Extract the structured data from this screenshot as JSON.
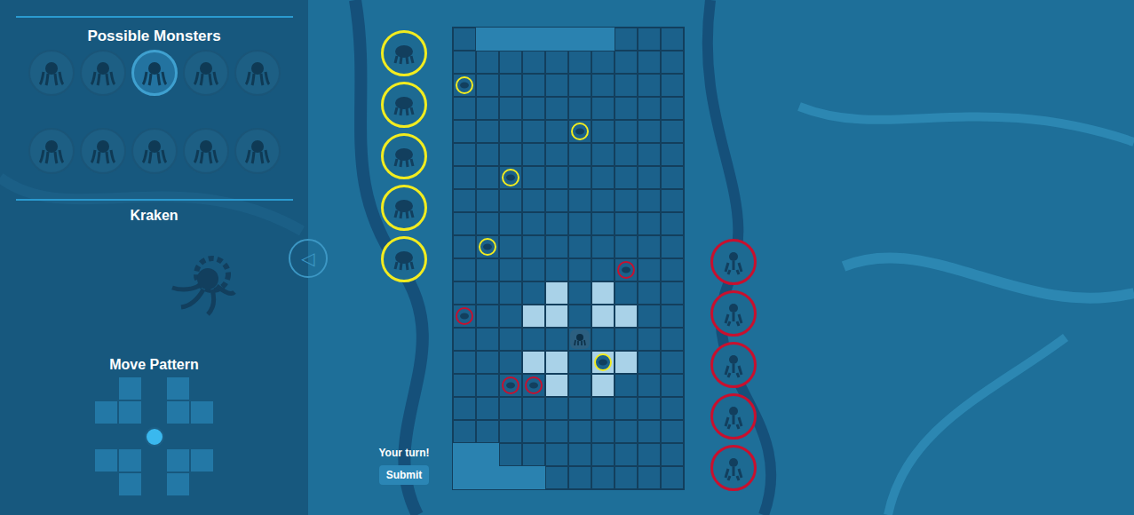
{
  "sidebar": {
    "title": "Possible Monsters",
    "monsters": [
      {
        "selected": false
      },
      {
        "selected": false
      },
      {
        "selected": true
      },
      {
        "selected": false
      },
      {
        "selected": false
      },
      {
        "selected": false
      },
      {
        "selected": false
      },
      {
        "selected": false
      },
      {
        "selected": false
      },
      {
        "selected": false
      }
    ],
    "monster_name": "Kraken",
    "move_pattern_title": "Move Pattern",
    "move_pattern": [
      [
        -1,
        -2
      ],
      [
        1,
        -2
      ],
      [
        -2,
        -1
      ],
      [
        -1,
        -1
      ],
      [
        1,
        -1
      ],
      [
        2,
        -1
      ],
      [
        -2,
        1
      ],
      [
        -1,
        1
      ],
      [
        1,
        1
      ],
      [
        2,
        1
      ],
      [
        -1,
        2
      ],
      [
        1,
        2
      ]
    ]
  },
  "back_button": "◁",
  "yellow_reserve": [
    {
      "color": "#f2ec1f"
    },
    {
      "color": "#f2ec1f"
    },
    {
      "color": "#f2ec1f"
    },
    {
      "color": "#f2ec1f"
    },
    {
      "color": "#f2ec1f"
    }
  ],
  "red_reserve": [
    {
      "color": "#c8102e"
    },
    {
      "color": "#c8102e"
    },
    {
      "color": "#c8102e"
    },
    {
      "color": "#c8102e"
    },
    {
      "color": "#c8102e"
    }
  ],
  "board": {
    "columns": 10,
    "rows": 20,
    "goal_cells": [
      [
        1,
        0
      ],
      [
        2,
        0
      ],
      [
        3,
        0
      ],
      [
        4,
        0
      ],
      [
        5,
        0
      ],
      [
        6,
        0
      ],
      [
        0,
        18
      ],
      [
        1,
        18
      ],
      [
        0,
        19
      ],
      [
        1,
        19
      ],
      [
        2,
        19
      ],
      [
        3,
        19
      ]
    ],
    "move_cells": [
      [
        4,
        11
      ],
      [
        6,
        11
      ],
      [
        3,
        12
      ],
      [
        4,
        12
      ],
      [
        6,
        12
      ],
      [
        7,
        12
      ],
      [
        3,
        14
      ],
      [
        4,
        14
      ],
      [
        6,
        14
      ],
      [
        7,
        14
      ],
      [
        4,
        15
      ],
      [
        6,
        15
      ]
    ],
    "pieces": [
      {
        "kind": "token",
        "color": "#f2ec1f",
        "col": 0,
        "row": 2
      },
      {
        "kind": "token",
        "color": "#f2ec1f",
        "col": 5,
        "row": 4
      },
      {
        "kind": "token",
        "color": "#f2ec1f",
        "col": 2,
        "row": 6
      },
      {
        "kind": "token",
        "color": "#f2ec1f",
        "col": 1,
        "row": 9
      },
      {
        "kind": "token",
        "color": "#f2ec1f",
        "col": 6,
        "row": 14
      },
      {
        "kind": "token",
        "color": "#c8102e",
        "col": 7,
        "row": 10
      },
      {
        "kind": "token",
        "color": "#c8102e",
        "col": 0,
        "row": 12
      },
      {
        "kind": "token",
        "color": "#c8102e",
        "col": 2,
        "row": 15
      },
      {
        "kind": "token",
        "color": "#c8102e",
        "col": 3,
        "row": 15
      },
      {
        "kind": "monster",
        "color": "#2c5f80",
        "col": 5,
        "row": 13
      }
    ]
  },
  "status": "Your turn!",
  "submit_button": "Submit"
}
